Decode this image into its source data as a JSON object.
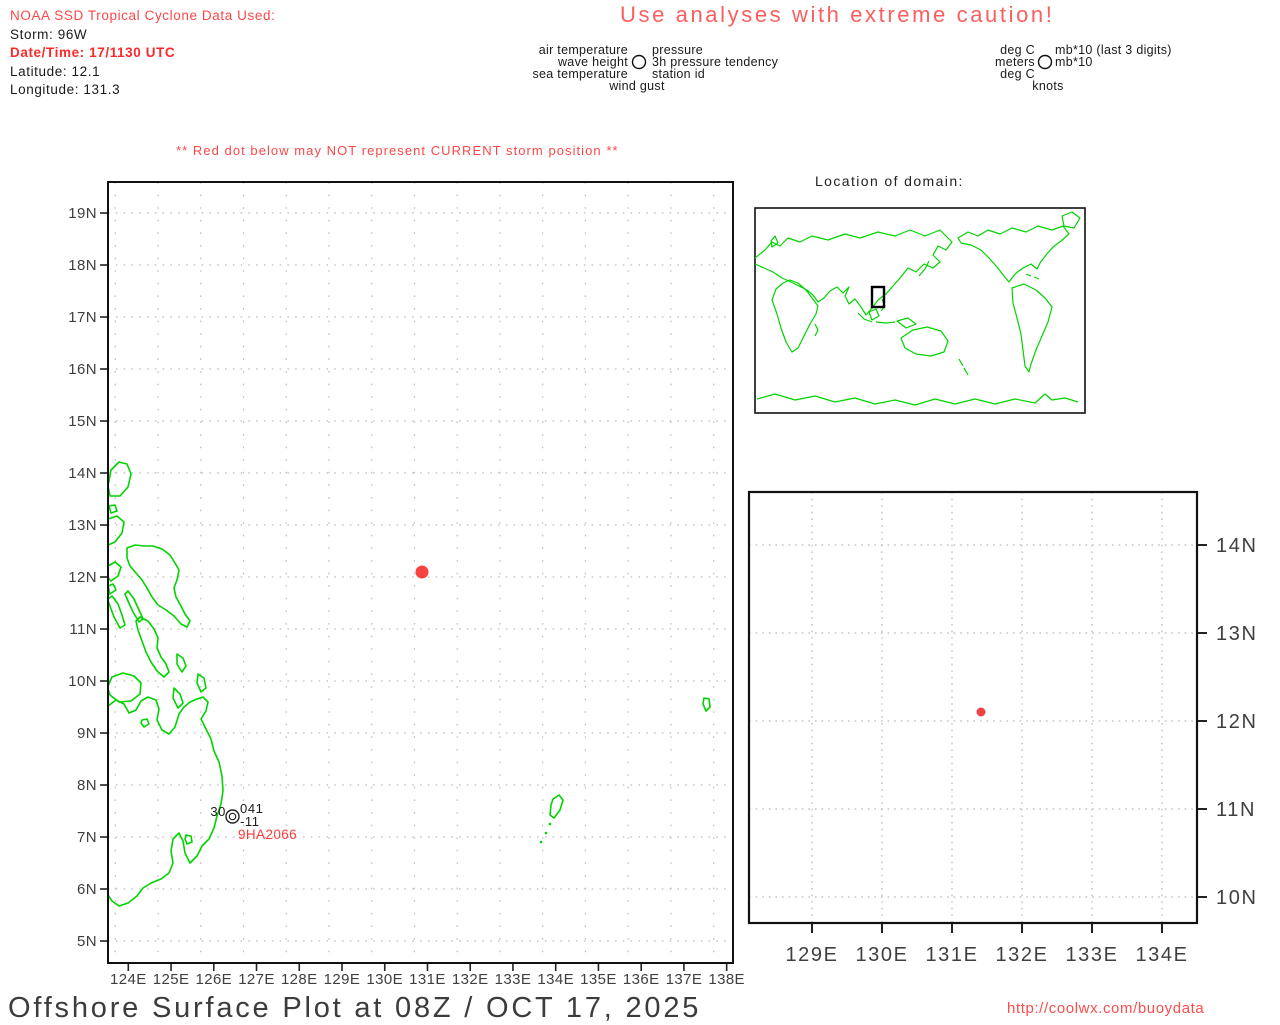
{
  "storm_info": {
    "title": "NOAA SSD Tropical Cyclone Data Used:",
    "storm": "Storm: 96W",
    "datetime": "Date/Time: 17/1130 UTC",
    "latitude": "Latitude: 12.1",
    "longitude": "Longitude: 131.3"
  },
  "caution_banner": "Use analyses with extreme caution!",
  "station_model_legend": {
    "air_temperature": "air temperature",
    "pressure": "pressure",
    "wave_height": "wave height",
    "pressure_tendency": "3h pressure tendency",
    "sea_temperature": "sea temperature",
    "station_id": "station id",
    "wind_gust": "wind gust",
    "units_air_temperature": "deg C",
    "units_pressure": "mb*10 (last 3 digits)",
    "units_wave_height": "meters",
    "units_pressure_tendency": "mb*10",
    "units_sea_temperature": "deg C",
    "units_wind_gust": "knots"
  },
  "warning": "** Red dot below may NOT represent CURRENT storm position **",
  "main_map": {
    "lon_labels": [
      "124E",
      "125E",
      "126E",
      "127E",
      "128E",
      "129E",
      "130E",
      "131E",
      "132E",
      "133E",
      "134E",
      "135E",
      "136E",
      "137E",
      "138E"
    ],
    "lat_labels": [
      "19N",
      "18N",
      "17N",
      "16N",
      "15N",
      "14N",
      "13N",
      "12N",
      "11N",
      "10N",
      "9N",
      "8N",
      "7N",
      "6N",
      "5N"
    ],
    "station_plot": {
      "air_temp": "30",
      "pressure": "041",
      "pressure_tendency": "-11",
      "station_id": "9HA2066"
    }
  },
  "domain_inset": {
    "title": "Location of domain:"
  },
  "detail_map": {
    "lon_labels": [
      "129E",
      "130E",
      "131E",
      "132E",
      "133E",
      "134E"
    ],
    "lat_labels": [
      "14N",
      "13N",
      "12N",
      "11N",
      "10N"
    ]
  },
  "footer": {
    "title": "Offshore Surface Plot at 08Z / OCT 17, 2025",
    "url": "http://coolwx.com/buoydata"
  },
  "colors": {
    "coastline_green": "#00d400",
    "storm_dot_red": "#f94343",
    "red_text": "#fb4747",
    "grid_gray": "#bcbcbc"
  },
  "chart_data": {
    "type": "map",
    "title": "Offshore Surface Plot at 08Z / OCT 17, 2025",
    "storm": {
      "id": "96W",
      "datetime_utc": "17/1130",
      "latitude": 12.1,
      "longitude": 131.3
    },
    "main_map_extent": {
      "lon": [
        124,
        138
      ],
      "lat": [
        5,
        19
      ]
    },
    "detail_map_extent": {
      "lon": [
        129,
        134
      ],
      "lat": [
        10,
        14
      ]
    },
    "grid_interval_deg": 1,
    "stations": [
      {
        "id": "9HA2066",
        "air_temperature_deg_c": 30,
        "pressure_mb10_last3": "041",
        "pressure_tendency_3h": "-11",
        "plotted_position": {
          "lat": 7.4,
          "lon": 126.4
        }
      }
    ]
  }
}
